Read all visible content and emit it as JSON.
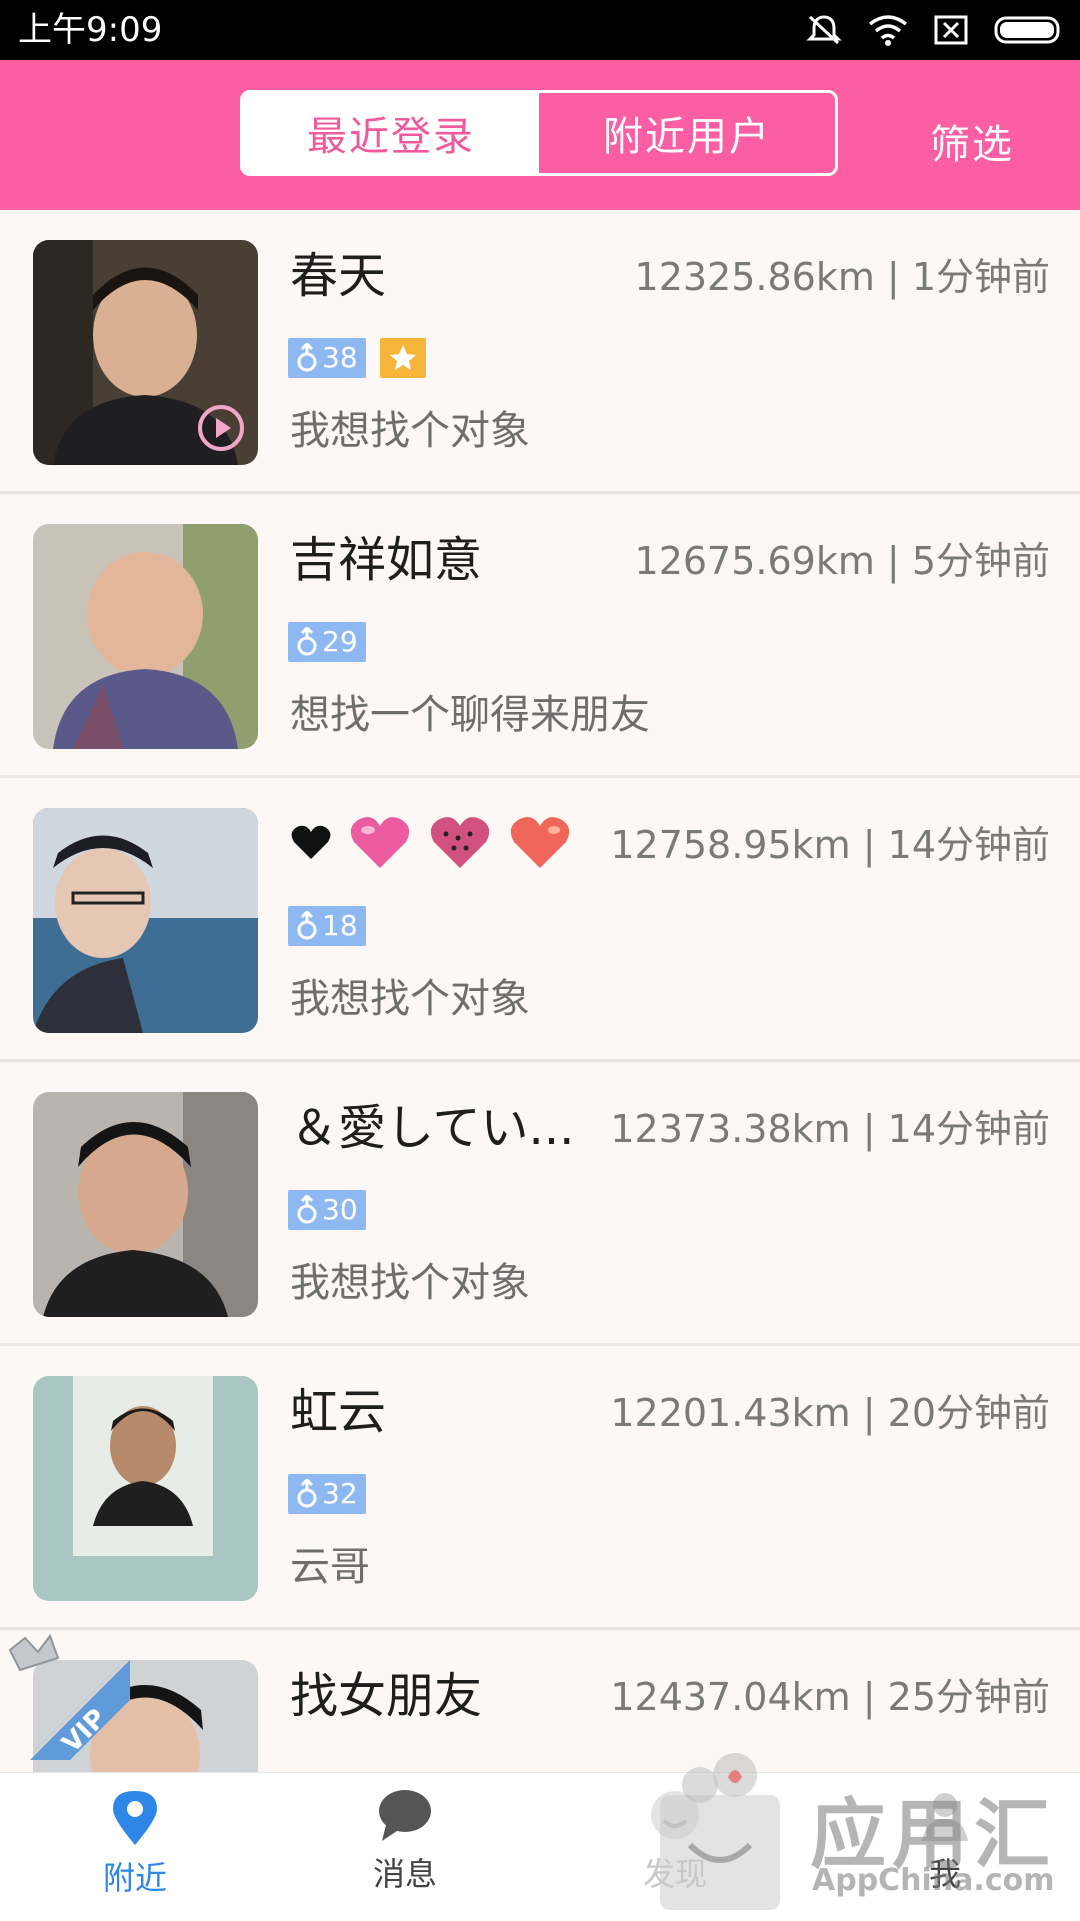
{
  "status_bar": {
    "time": "上午9:09"
  },
  "header": {
    "tabs": [
      {
        "label": "最近登录",
        "active": true
      },
      {
        "label": "附近用户",
        "active": false
      }
    ],
    "filter_label": "筛选"
  },
  "users": [
    {
      "name": "春天",
      "meta": "12325.86km | 1分钟前",
      "age": "38",
      "star": true,
      "status": "我想找个对象"
    },
    {
      "name": "吉祥如意",
      "meta": "12675.69km | 5分钟前",
      "age": "29",
      "star": false,
      "status": "想找一个聊得来朋友"
    },
    {
      "name": "",
      "meta": "12758.95km | 14分钟前",
      "age": "18",
      "star": false,
      "status": "我想找个对象"
    },
    {
      "name": "＆愛してい...",
      "meta": "12373.38km | 14分钟前",
      "age": "30",
      "star": false,
      "status": "我想找个对象"
    },
    {
      "name": "虹云",
      "meta": "12201.43km | 20分钟前",
      "age": "32",
      "star": false,
      "status": "云哥"
    },
    {
      "name": "找女朋友",
      "meta": "12437.04km | 25分钟前",
      "vip_label": "VIP"
    }
  ],
  "bottom_nav": [
    {
      "label": "附近",
      "icon": "location-pin-icon",
      "active": true
    },
    {
      "label": "消息",
      "icon": "chat-bubble-icon",
      "active": false
    },
    {
      "label": "发现",
      "icon": "discover-icon",
      "active": false
    },
    {
      "label": "我",
      "icon": "profile-icon",
      "active": false
    }
  ],
  "watermark": {
    "title": "应用汇",
    "subtitle": "AppChina.com"
  },
  "colors": {
    "accent": "#fb5ea3",
    "nav_active": "#2e86e6",
    "age_badge": "#8eb8f2",
    "star_badge": "#f6b43a"
  }
}
